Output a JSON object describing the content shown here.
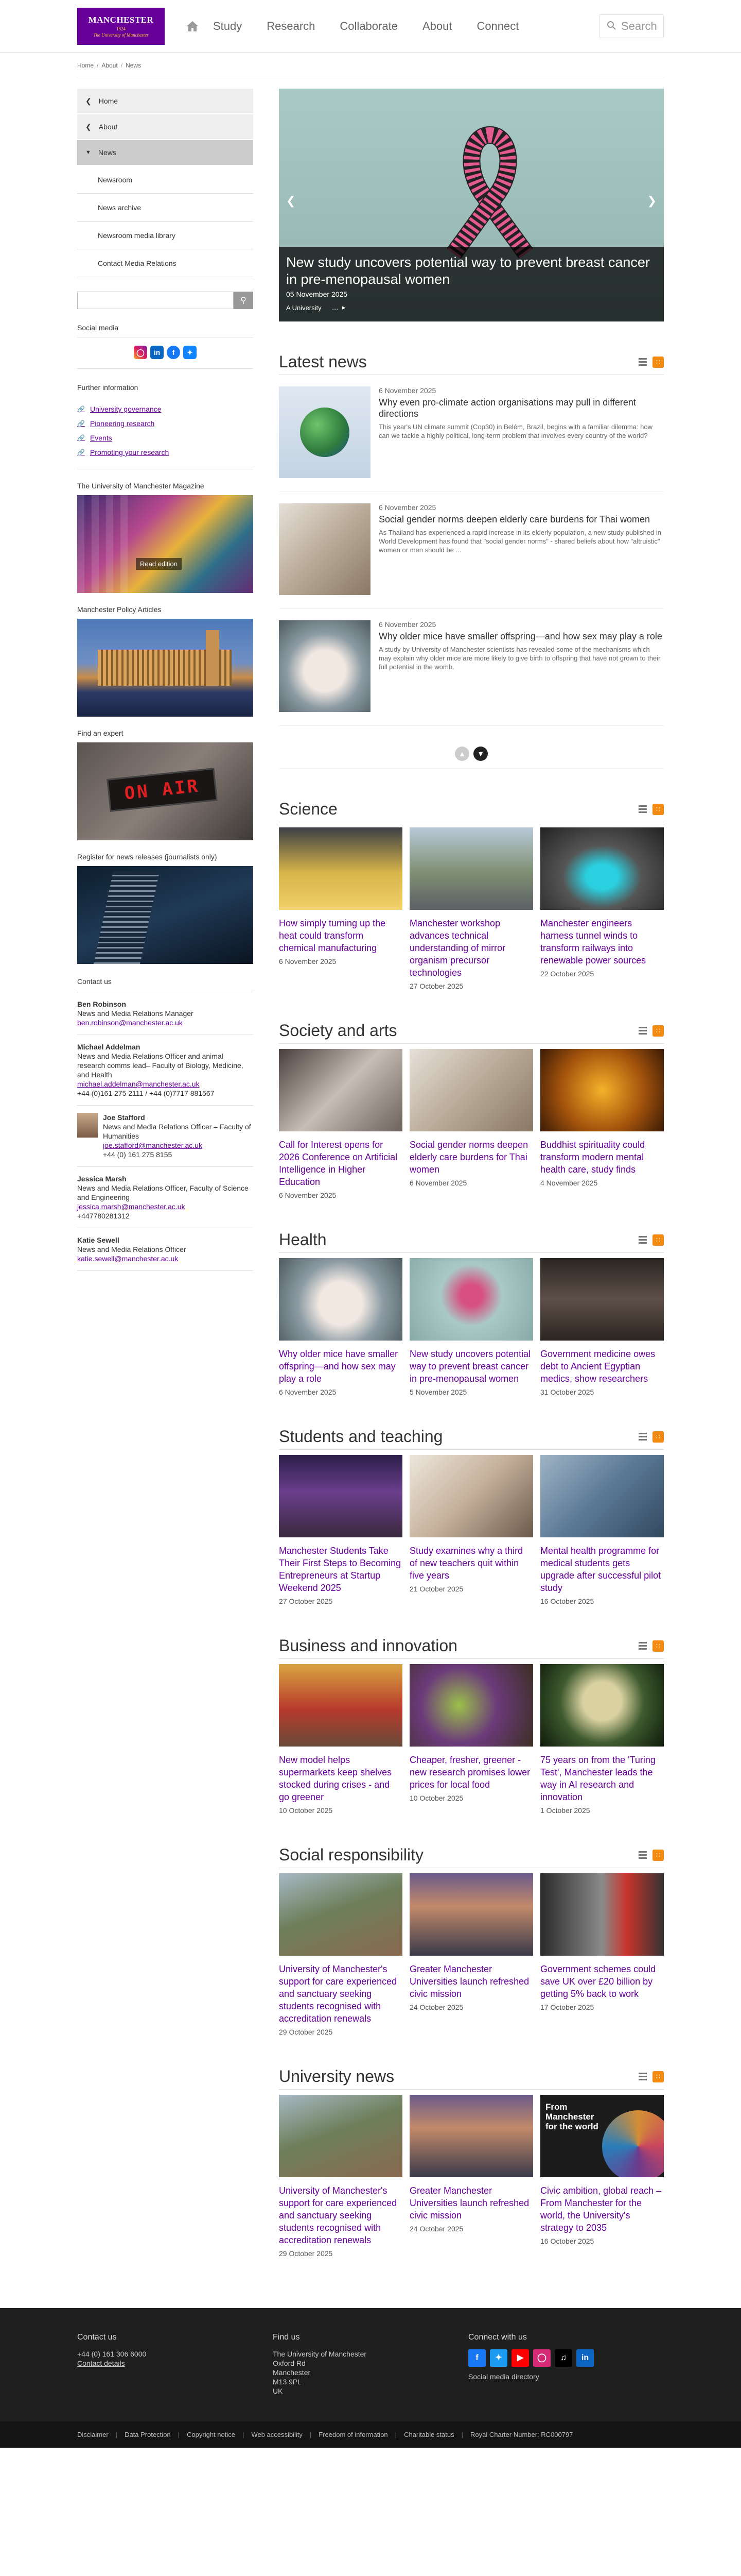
{
  "header": {
    "logo": {
      "line1": "MANCHESTER",
      "line2": "1824",
      "line3": "The University of Manchester"
    },
    "nav": [
      "Study",
      "Research",
      "Collaborate",
      "About",
      "Connect"
    ],
    "search_label": "Search"
  },
  "breadcrumb": [
    "Home",
    "About",
    "News"
  ],
  "sidebar": {
    "nav": [
      {
        "label": "Home",
        "icon": "chevron-left"
      },
      {
        "label": "About",
        "icon": "chevron-left"
      },
      {
        "label": "News",
        "icon": "chevron-down",
        "active": true
      }
    ],
    "sub": [
      "Newsroom",
      "News archive",
      "Newsroom media library",
      "Contact Media Relations"
    ],
    "social_heading": "Social media",
    "further_heading": "Further information",
    "further_links": [
      "University governance",
      "Pioneering research",
      "Events",
      "Promoting your research"
    ],
    "promos": [
      {
        "heading": "The University of Manchester Magazine",
        "overlay": "Read edition"
      },
      {
        "heading": "Manchester Policy Articles"
      },
      {
        "heading": "Find an expert",
        "sign": "ON AIR"
      },
      {
        "heading": "Register for news releases (journalists only)"
      }
    ],
    "contact_heading": "Contact us",
    "contacts": [
      {
        "name": "Ben Robinson",
        "role": "News and Media Relations Manager",
        "email": "ben.robinson@manchester.ac.uk",
        "phone": ""
      },
      {
        "name": "Michael Addelman",
        "role": "News and Media Relations Officer and animal research comms lead– Faculty of Biology, Medicine, and Health",
        "email": "michael.addelman@manchester.ac.uk",
        "phone": "+44 (0)161 275 2111 / +44 (0)7717 881567"
      },
      {
        "name": "Joe Stafford",
        "role": "News and Media Relations Officer – Faculty of Humanities",
        "email": "joe.stafford@manchester.ac.uk",
        "phone": "+44 (0) 161 275 8155",
        "photo": true
      },
      {
        "name": "Jessica Marsh",
        "role": "News and Media Relations Officer, Faculty of Science and Engineering",
        "email": "jessica.marsh@manchester.ac.uk",
        "phone": "+447780281312"
      },
      {
        "name": "Katie Sewell",
        "role": "News and Media Relations Officer",
        "email": "katie.sewell@manchester.ac.uk",
        "phone": ""
      }
    ]
  },
  "hero": {
    "title": "New study uncovers potential way to prevent breast cancer in pre-menopausal women",
    "date": "05 November 2025",
    "snippet": "A University"
  },
  "latest": {
    "title": "Latest news",
    "items": [
      {
        "date": "6 November 2025",
        "title": "Why even pro-climate action organisations may pull in different directions",
        "excerpt": "This year's UN climate summit (Cop30) in Belém, Brazil, begins with a familiar dilemma: how can we tackle a highly political, long-term problem that involves every country of the world?"
      },
      {
        "date": "6 November 2025",
        "title": "Social gender norms deepen elderly care burdens for Thai women",
        "excerpt": "As Thailand has experienced a rapid increase in its elderly population, a new study published in World Development has found that \"social gender norms\" - shared beliefs about how \"altruistic\" women or men should be ..."
      },
      {
        "date": "6 November 2025",
        "title": "Why older mice have smaller offspring—and how sex may play a role",
        "excerpt": "A study by University of Manchester scientists has revealed some of the mechanisms which may explain why older mice are more likely to give birth to offspring that have not grown to their full potential in the womb."
      }
    ]
  },
  "sections": [
    {
      "title": "Science",
      "cards": [
        {
          "title": "How simply turning up the heat could transform chemical manufacturing",
          "date": "6 November 2025"
        },
        {
          "title": "Manchester workshop advances technical understanding of mirror organism precursor technologies",
          "date": "27 October 2025"
        },
        {
          "title": "Manchester engineers harness tunnel winds to transform railways into renewable power sources",
          "date": "22 October 2025"
        }
      ]
    },
    {
      "title": "Society and arts",
      "cards": [
        {
          "title": "Call for Interest opens for 2026 Conference on Artificial Intelligence in Higher Education",
          "date": "6 November 2025"
        },
        {
          "title": "Social gender norms deepen elderly care burdens for Thai women",
          "date": "6 November 2025"
        },
        {
          "title": "Buddhist spirituality could transform modern mental health care, study finds",
          "date": "4 November 2025"
        }
      ]
    },
    {
      "title": "Health",
      "cards": [
        {
          "title": "Why older mice have smaller offspring—and how sex may play a role",
          "date": "6 November 2025"
        },
        {
          "title": "New study uncovers potential way to prevent breast cancer in pre-menopausal women",
          "date": "5 November 2025"
        },
        {
          "title": "Government medicine owes debt to Ancient Egyptian medics, show researchers",
          "date": "31 October 2025"
        }
      ]
    },
    {
      "title": "Students and teaching",
      "cards": [
        {
          "title": "Manchester Students Take Their First Steps to Becoming Entrepreneurs at Startup Weekend 2025",
          "date": "27 October 2025"
        },
        {
          "title": "Study examines why a third of new teachers quit within five years",
          "date": "21 October 2025"
        },
        {
          "title": "Mental health programme for medical students gets upgrade after successful pilot study",
          "date": "16 October 2025"
        }
      ]
    },
    {
      "title": "Business and innovation",
      "cards": [
        {
          "title": "New model helps supermarkets keep shelves stocked during crises - and go greener",
          "date": "10 October 2025"
        },
        {
          "title": "Cheaper, fresher, greener - new research promises lower prices for local food",
          "date": "10 October 2025"
        },
        {
          "title": "75 years on from the 'Turing Test', Manchester leads the way in AI research and innovation",
          "date": "1 October 2025"
        }
      ]
    },
    {
      "title": "Social responsibility",
      "cards": [
        {
          "title": "University of Manchester's support for care experienced and sanctuary seeking students recognised with accreditation renewals",
          "date": "29 October 2025"
        },
        {
          "title": "Greater Manchester Universities launch refreshed civic mission",
          "date": "24 October 2025"
        },
        {
          "title": "Government schemes could save UK over £20 billion by getting 5% back to work",
          "date": "17 October 2025"
        }
      ]
    },
    {
      "title": "University news",
      "cards": [
        {
          "title": "University of Manchester's support for care experienced and sanctuary seeking students recognised with accreditation renewals",
          "date": "29 October 2025"
        },
        {
          "title": "Greater Manchester Universities launch refreshed civic mission",
          "date": "24 October 2025"
        },
        {
          "title": "Civic ambition, global reach – From Manchester for the world, the University's strategy to 2035",
          "date": "16 October 2025",
          "image_text": "From Manchester for the world"
        }
      ]
    }
  ],
  "footer": {
    "contact_heading": "Contact us",
    "phone": "+44 (0) 161 306 6000",
    "contact_details": "Contact details",
    "find_heading": "Find us",
    "address": [
      "The University of Manchester",
      "Oxford Rd",
      "Manchester",
      "M13 9PL",
      "UK"
    ],
    "connect_heading": "Connect with us",
    "social_directory": "Social media directory"
  },
  "subfooter": [
    "Disclaimer",
    "Data Protection",
    "Copyright notice",
    "Web accessibility",
    "Freedom of information",
    "Charitable status",
    "Royal Charter Number: RC000797"
  ],
  "colors": {
    "brand": "#660099",
    "gold": "#ffcc33",
    "rss": "#f38a12"
  }
}
